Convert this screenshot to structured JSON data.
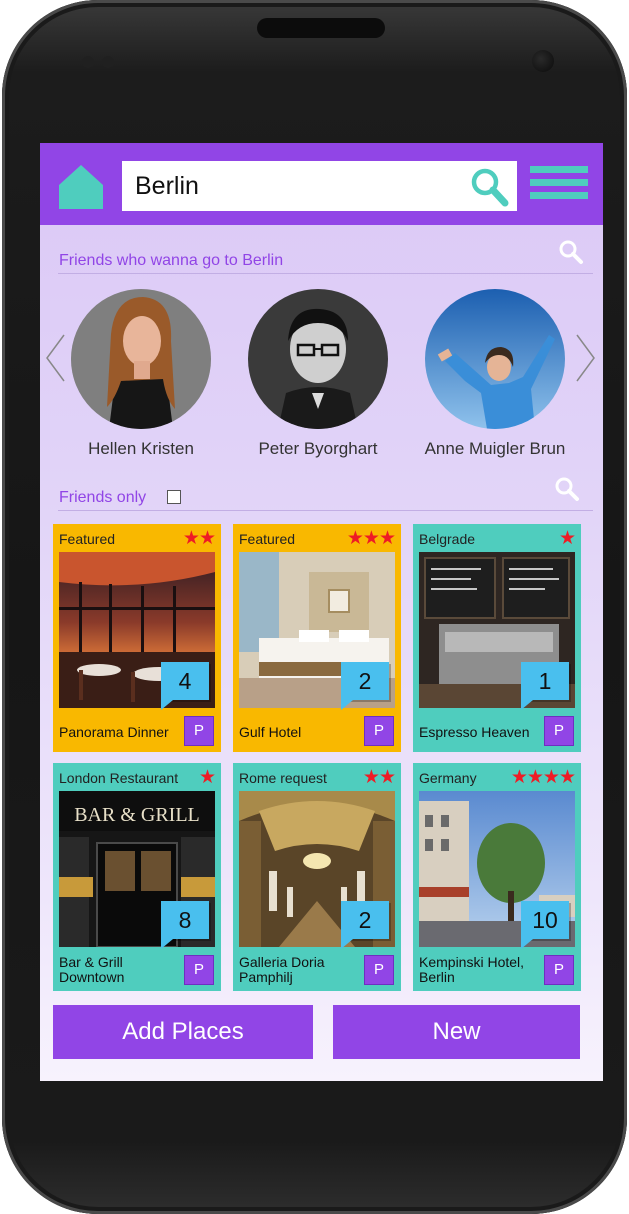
{
  "colors": {
    "primary": "#9145e6",
    "teal": "#4fcdbe",
    "orange": "#f9b800",
    "badge": "#49bfee",
    "star": "#ee1c25"
  },
  "header": {
    "search_value": "Berlin",
    "home_icon": "home-icon",
    "search_icon": "search-icon",
    "menu_icon": "hamburger-menu-icon"
  },
  "friends_section": {
    "title": "Friends who wanna go to Berlin",
    "friends": [
      {
        "name": "Hellen Kristen"
      },
      {
        "name": "Peter Byorghart"
      },
      {
        "name": "Anne Muigler Brun"
      }
    ]
  },
  "filter": {
    "friends_only_label": "Friends only",
    "friends_only_checked": false
  },
  "places": [
    {
      "tag": "Featured",
      "stars": "★★",
      "rating": 2,
      "count": "4",
      "name": "Panorama Dinner",
      "p": "P",
      "color": "orange"
    },
    {
      "tag": "Featured",
      "stars": "★★★",
      "rating": 3,
      "count": "2",
      "name": "Gulf Hotel",
      "p": "P",
      "color": "orange"
    },
    {
      "tag": "Belgrade",
      "stars": "★",
      "rating": 1,
      "count": "1",
      "name": "Espresso Heaven",
      "p": "P",
      "color": "teal"
    },
    {
      "tag": "London Restaurant",
      "stars": "★",
      "rating": 1,
      "count": "8",
      "name_line1": "Bar & Grill",
      "name_line2": "Downtown",
      "p": "P",
      "color": "teal"
    },
    {
      "tag": "Rome request",
      "stars": "★★",
      "rating": 2,
      "count": "2",
      "name_line1": "Galleria Doria",
      "name_line2": "Pamphilj",
      "p": "P",
      "color": "teal"
    },
    {
      "tag": "Germany",
      "stars": "★★★★",
      "rating": 4,
      "count": "10",
      "name_line1": "Kempinski Hotel,",
      "name_line2": "Berlin",
      "p": "P",
      "color": "teal"
    }
  ],
  "bar_sign": {
    "line1": "BAR & GRILL"
  },
  "buttons": {
    "add_places": "Add Places",
    "new": "New"
  }
}
